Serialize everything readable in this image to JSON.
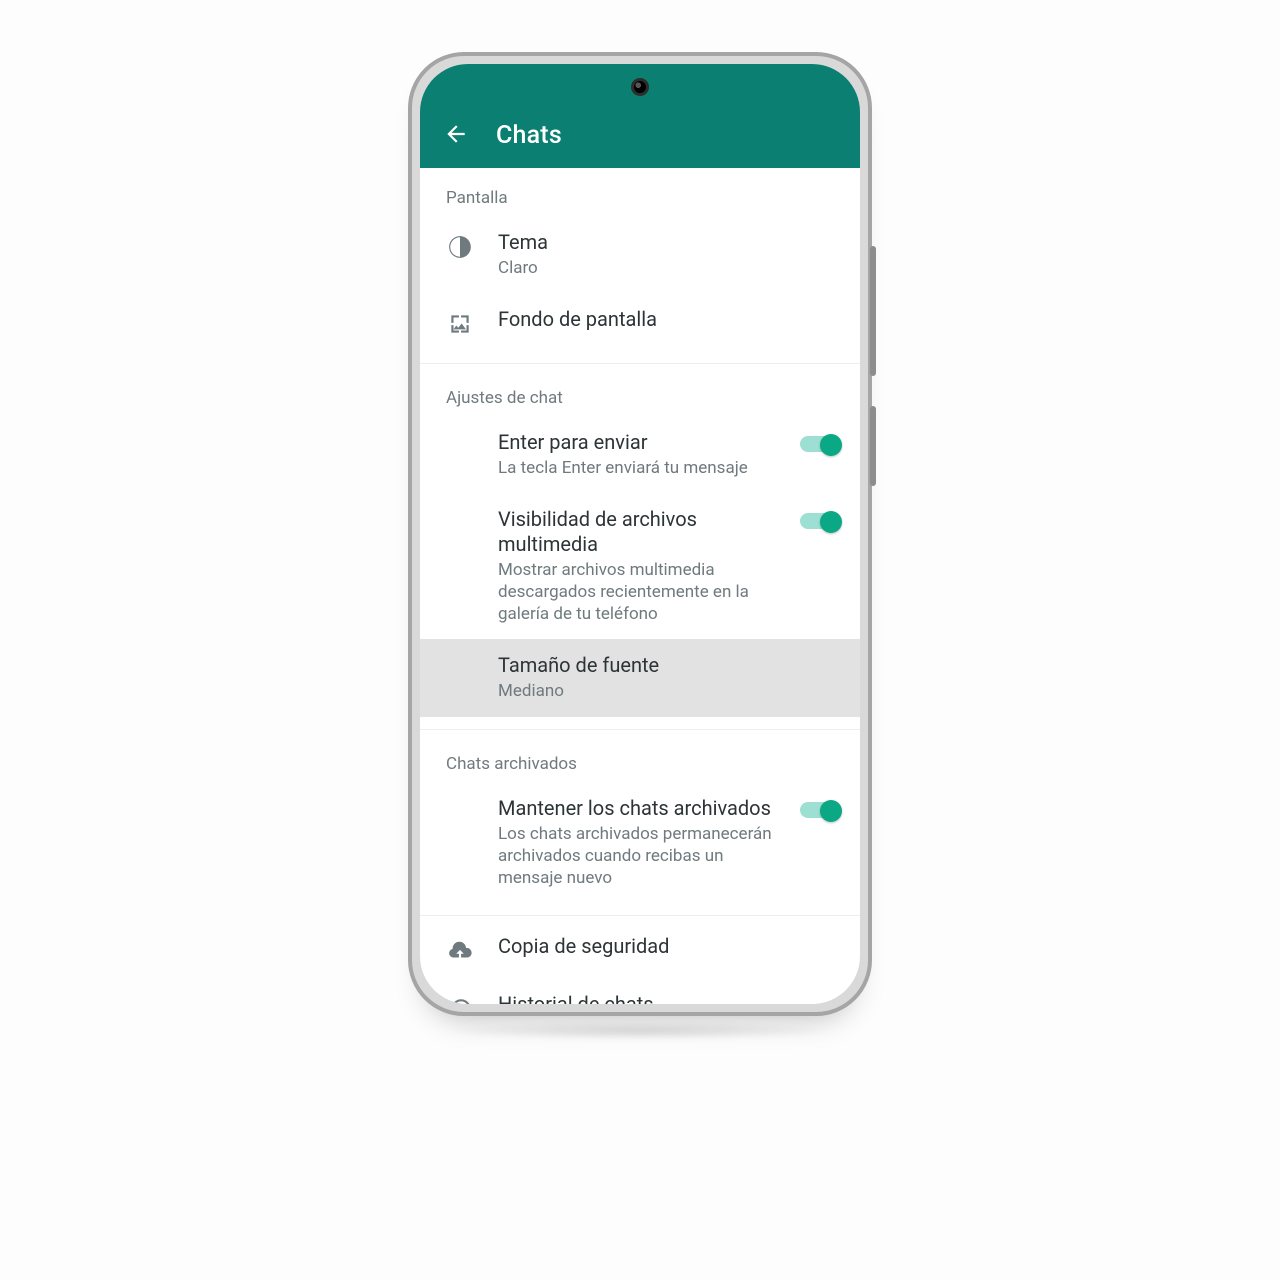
{
  "appbar": {
    "title": "Chats"
  },
  "sections": {
    "display": {
      "header": "Pantalla",
      "theme": {
        "title": "Tema",
        "value": "Claro"
      },
      "wallpaper": {
        "title": "Fondo de pantalla"
      }
    },
    "chat": {
      "header": "Ajustes de chat",
      "enter_send": {
        "title": "Enter para enviar",
        "desc": "La tecla Enter enviará tu mensaje",
        "on": true
      },
      "media_visibility": {
        "title": "Visibilidad de archivos multimedia",
        "desc": "Mostrar archivos multimedia descargados recientemente en la galería de tu teléfono",
        "on": true
      },
      "font_size": {
        "title": "Tamaño de fuente",
        "value": "Mediano"
      }
    },
    "archived": {
      "header": "Chats archivados",
      "keep_archived": {
        "title": "Mantener los chats archivados",
        "desc": "Los chats archivados permanecerán archivados cuando recibas un mensaje nuevo",
        "on": true
      }
    },
    "other": {
      "backup": {
        "title": "Copia de seguridad"
      },
      "history": {
        "title": "Historial de chats"
      }
    }
  },
  "colors": {
    "primary": "#0b7f71",
    "accent": "#0aa884"
  }
}
